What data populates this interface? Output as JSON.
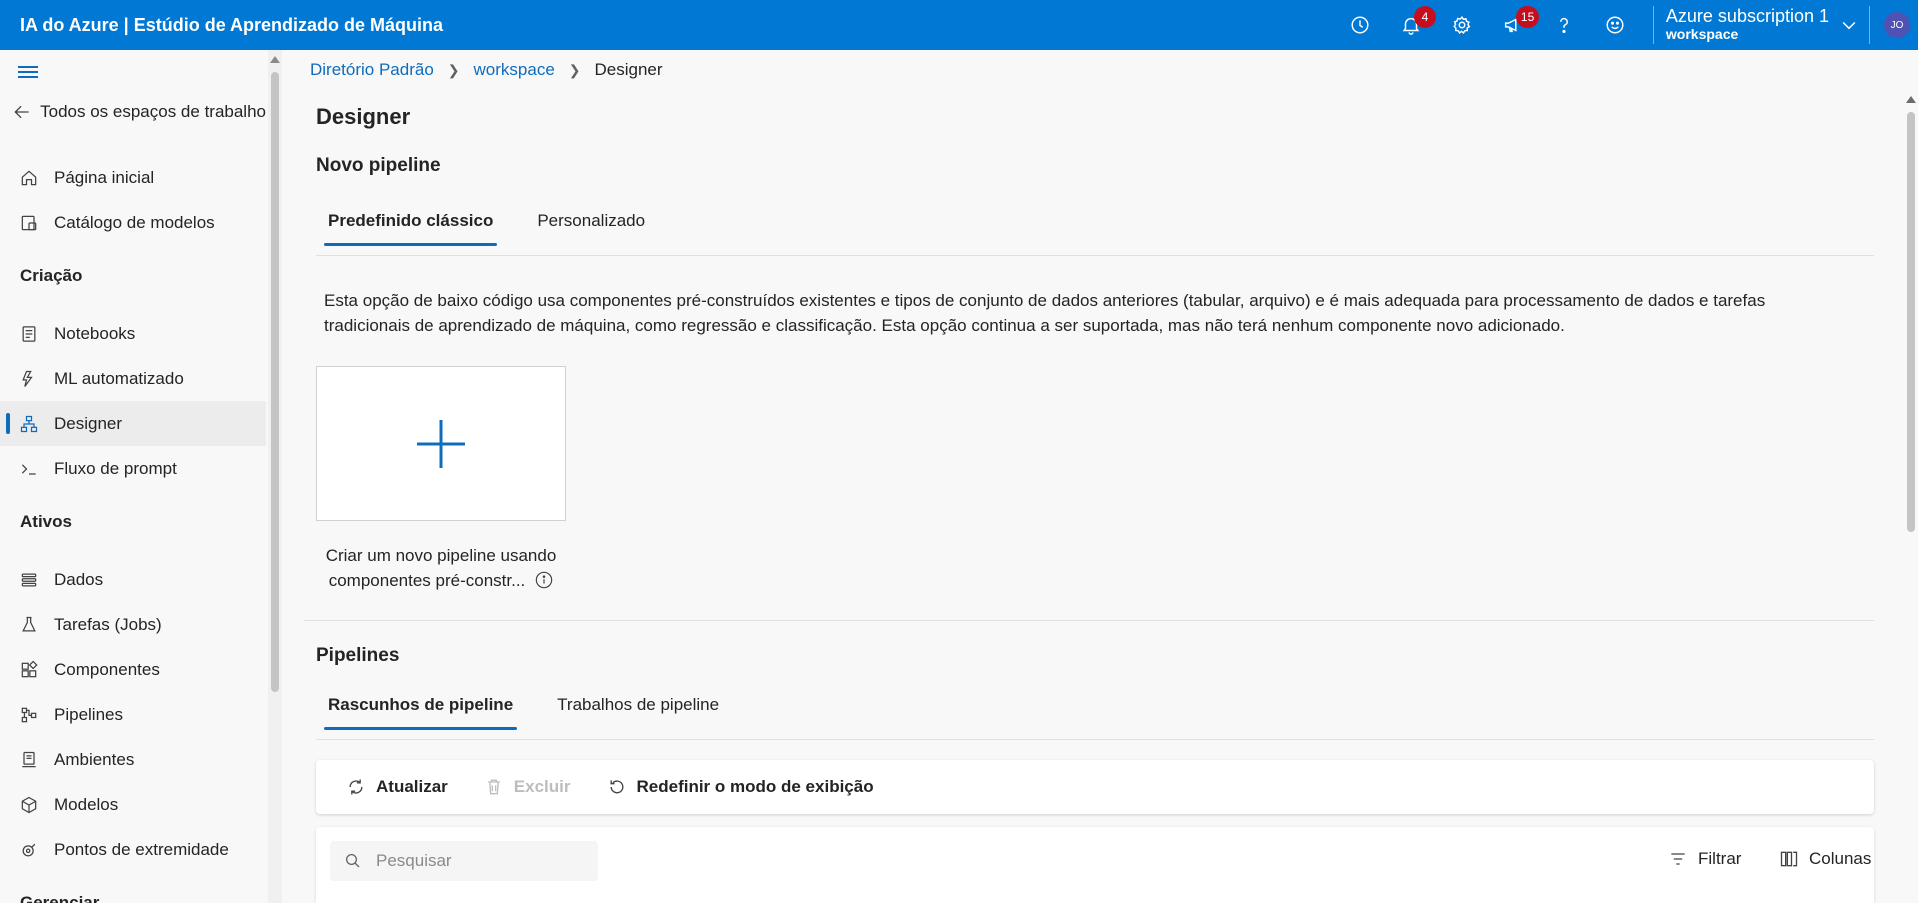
{
  "app": {
    "title": "IA do Azure | Estúdio de Aprendizado de Máquina"
  },
  "topbar": {
    "notifications_count": "4",
    "feedback_count": "15",
    "subscription_name": "Azure subscription 1",
    "workspace_name": "workspace",
    "avatar_initials": "JO",
    "icons": [
      "history-icon",
      "bell-icon",
      "gear-icon",
      "megaphone-icon",
      "help-icon",
      "smiley-icon",
      "chevron-down-icon"
    ]
  },
  "sidebar": {
    "back_label": "Todos os espaços de trabalho",
    "home": "Página inicial",
    "model_catalog": "Catálogo de modelos",
    "section_authoring": "Criação",
    "notebooks": "Notebooks",
    "automl": "ML automatizado",
    "designer": "Designer",
    "prompt_flow": "Fluxo de prompt",
    "section_assets": "Ativos",
    "data": "Dados",
    "jobs": "Tarefas (Jobs)",
    "components": "Componentes",
    "pipelines": "Pipelines",
    "environments": "Ambientes",
    "models": "Modelos",
    "endpoints": "Pontos de extremidade",
    "section_manage": "Gerenciar"
  },
  "breadcrumb": {
    "dir": "Diretório Padrão",
    "workspace": "workspace",
    "current": "Designer"
  },
  "main": {
    "page_title": "Designer",
    "new_pipeline_title": "Novo pipeline",
    "tab_classic": "Predefinido clássico",
    "tab_custom": "Personalizado",
    "description": "Esta opção de baixo código usa componentes pré-construídos existentes e tipos de conjunto de dados anteriores (tabular, arquivo) e é mais adequada para processamento de dados e tarefas tradicionais de aprendizado de máquina, como regressão e classificação. Esta opção continua a ser suportada, mas não terá nenhum componente novo adicionado.",
    "create_label_line1": "Criar um novo pipeline usando",
    "create_label_line2": "componentes pré-constr...",
    "pipelines_title": "Pipelines",
    "tab_drafts": "Rascunhos de pipeline",
    "tab_jobs": "Trabalhos de pipeline"
  },
  "toolbar": {
    "refresh": "Atualizar",
    "delete": "Excluir",
    "reset_view": "Redefinir o modo de exibição"
  },
  "list": {
    "search_placeholder": "Pesquisar",
    "filter": "Filtrar",
    "columns": "Colunas"
  },
  "colors": {
    "brand": "#0078d4",
    "accent": "#0f6cbd",
    "badge": "#c50f1f"
  }
}
